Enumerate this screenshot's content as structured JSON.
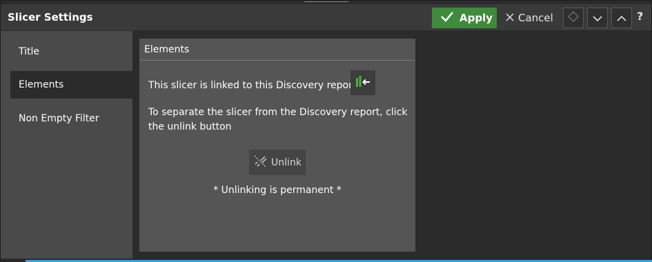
{
  "window": {
    "title": "Slicer Settings"
  },
  "toolbar": {
    "apply_label": "Apply",
    "cancel_label": "Cancel",
    "help_label": "?"
  },
  "sidebar": {
    "items": [
      {
        "label": "Title"
      },
      {
        "label": "Elements"
      },
      {
        "label": "Non Empty Filter"
      }
    ],
    "active_index": 1
  },
  "panel": {
    "header": "Elements",
    "linked_text": "This slicer is linked to this Discovery report :",
    "separate_text": "To separate the slicer from the Discovery report, click the unlink button",
    "unlink_label": "Unlink",
    "warning_text": "* Unlinking is permanent *"
  },
  "colors": {
    "accent_green": "#3f8a3c",
    "icon_green": "#4caf3e",
    "focus_blue": "#39a0e0"
  }
}
